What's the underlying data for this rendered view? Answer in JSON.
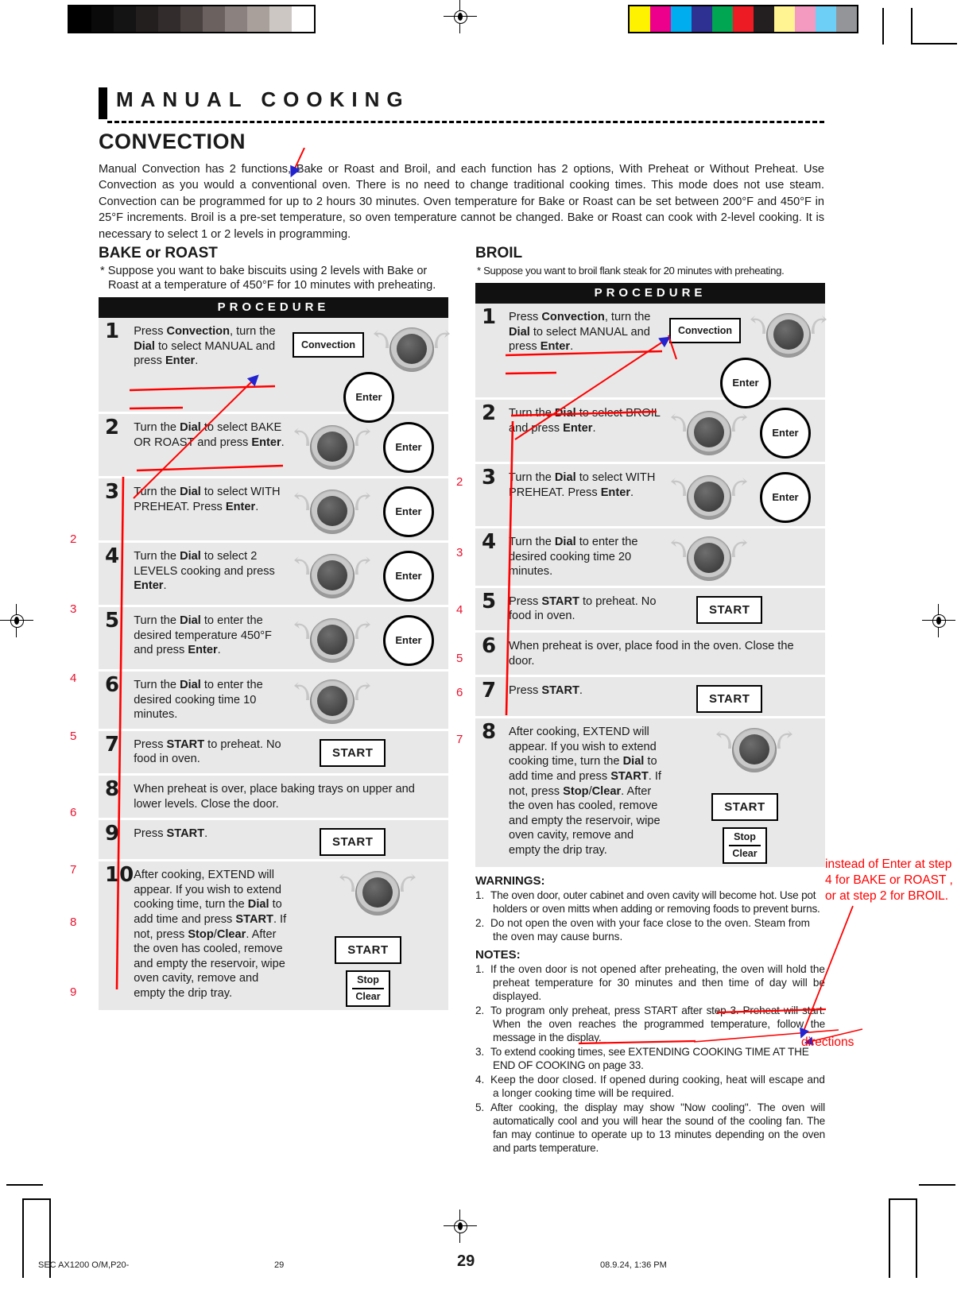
{
  "print": {
    "grey_swatches": [
      "#000000",
      "#0a0a0a",
      "#141414",
      "#241f1f",
      "#322c2c",
      "#4a4240",
      "#6b6260",
      "#8b817e",
      "#a9a09c",
      "#cdc7c3",
      "#ffffff"
    ],
    "color_swatches": [
      "#fff200",
      "#ec008c",
      "#00aeef",
      "#2e3192",
      "#00a651",
      "#ed1c24",
      "#231f20",
      "#fff392",
      "#f49ac1",
      "#6dcff6",
      "#939598"
    ],
    "registration_icon": "registration-target-icon"
  },
  "header": {
    "title": "MANUAL COOKING",
    "section_title": "CONVECTION",
    "intro": "Manual Convection has 2 functions, Bake or Roast and Broil, and each function has 2 options, With Preheat or Without Preheat. Use Convection as you would a conventional oven. There is no need to change traditional cooking times. This mode does not use steam. Convection can be programmed for up to 2 hours 30 minutes. Oven temperature for Bake or Roast can be set between 200°F and 450°F in 25°F increments. Broil is a pre-set temperature, so oven temperature cannot be changed. Bake or Roast can cook with 2-level cooking. It is necessary to select 1 or 2 levels in programming."
  },
  "left": {
    "heading": "BAKE or ROAST",
    "suppose": "* Suppose you want to bake biscuits using 2 levels with Bake or Roast at a temperature of 450°F for 10 minutes with preheating.",
    "procedure_label": "PROCEDURE",
    "steps": [
      {
        "num": "1",
        "text": "Press Convection, turn the Dial to select MANUAL and press Enter.",
        "bold": [
          "Convection",
          "Dial",
          "Enter"
        ],
        "art": [
          "convection-button",
          "dial-knob",
          "enter-button"
        ]
      },
      {
        "num": "2",
        "text": "Turn the Dial to select BAKE OR ROAST and press Enter.",
        "bold": [
          "Dial",
          "Enter"
        ],
        "art": [
          "dial-knob",
          "enter-button"
        ]
      },
      {
        "num": "3",
        "text": "Turn the Dial to select WITH PREHEAT. Press Enter.",
        "bold": [
          "Dial",
          "Enter"
        ],
        "art": [
          "dial-knob",
          "enter-button"
        ]
      },
      {
        "num": "4",
        "text": "Turn the Dial to select 2 LEVELS cooking and press Enter.",
        "bold": [
          "Dial",
          "Enter"
        ],
        "art": [
          "dial-knob",
          "enter-button"
        ]
      },
      {
        "num": "5",
        "text": "Turn the Dial to enter the desired temperature 450°F and press Enter.",
        "bold": [
          "Dial",
          "Enter"
        ],
        "art": [
          "dial-knob",
          "enter-button"
        ]
      },
      {
        "num": "6",
        "text": "Turn the Dial to enter the desired cooking time 10 minutes.",
        "bold": [
          "Dial"
        ],
        "art": [
          "dial-knob"
        ]
      },
      {
        "num": "7",
        "text": "Press START to preheat. No food in oven.",
        "bold": [
          "START"
        ],
        "art": [
          "start-button"
        ]
      },
      {
        "num": "8",
        "text": "When preheat is over, place baking trays on upper and lower levels. Close the door.",
        "bold": [],
        "art": []
      },
      {
        "num": "9",
        "text": "Press START.",
        "bold": [
          "START"
        ],
        "art": [
          "start-button"
        ]
      },
      {
        "num": "10",
        "text": "After cooking, EXTEND will appear. If you wish to extend cooking time, turn the Dial to add time and press START. If not, press Stop/Clear. After the oven has cooled, remove and empty the reservoir, wipe oven cavity, remove and empty the drip tray.",
        "bold": [
          "Dial",
          "START",
          "Stop",
          "Clear"
        ],
        "art": [
          "dial-knob",
          "start-button",
          "stop-clear-button"
        ]
      }
    ]
  },
  "right": {
    "heading": "BROIL",
    "suppose": "*  Suppose you want to broil flank steak for 20 minutes with preheating.",
    "procedure_label": "PROCEDURE",
    "steps": [
      {
        "num": "1",
        "text": "Press Convection, turn the Dial to select MANUAL and press Enter.",
        "bold": [
          "Convection",
          "Dial",
          "Enter"
        ],
        "art": [
          "convection-button",
          "dial-knob",
          "enter-button"
        ]
      },
      {
        "num": "2",
        "text": "Turn the Dial to select BROIL and press Enter.",
        "bold": [
          "Dial",
          "Enter"
        ],
        "art": [
          "dial-knob",
          "enter-button"
        ]
      },
      {
        "num": "3",
        "text": "Turn the Dial to select WITH PREHEAT. Press Enter.",
        "bold": [
          "Dial",
          "Enter"
        ],
        "art": [
          "dial-knob",
          "enter-button"
        ]
      },
      {
        "num": "4",
        "text": "Turn the Dial to enter the desired cooking time 20 minutes.",
        "bold": [
          "Dial"
        ],
        "art": [
          "dial-knob"
        ]
      },
      {
        "num": "5",
        "text": "Press START to preheat. No food in oven.",
        "bold": [
          "START"
        ],
        "art": [
          "start-button"
        ]
      },
      {
        "num": "6",
        "text": "When preheat is over, place food in the oven. Close the door.",
        "bold": [],
        "art": []
      },
      {
        "num": "7",
        "text": "Press START.",
        "bold": [
          "START"
        ],
        "art": [
          "start-button"
        ]
      },
      {
        "num": "8",
        "text": "After cooking, EXTEND will appear. If you wish to extend cooking time, turn the Dial to add time and press START. If not, press Stop/Clear. After the oven has cooled, remove and empty the reservoir, wipe oven cavity, remove and empty the drip tray.",
        "bold": [
          "Dial",
          "START",
          "Stop",
          "Clear"
        ],
        "art": [
          "dial-knob",
          "start-button",
          "stop-clear-button"
        ]
      }
    ],
    "warnings_title": "WARNINGS:",
    "warnings": [
      "The oven door, outer cabinet and oven cavity will become hot. Use pot holders or oven mitts when adding or removing foods to prevent burns.",
      "Do not open the oven with your face close  to the oven. Steam from the oven may cause burns."
    ],
    "notes_title": "NOTES:",
    "notes": [
      "If the oven door is not opened after preheating, the oven will hold the preheat temperature for 30 minutes and then time of day will be displayed.",
      "To program only preheat, press START after step 3. Preheat will start. When the oven reaches the programmed temperature, follow the message in the display.",
      "To extend cooking times, see EXTENDING COOKING TIME AT THE END OF COOKING on page 33.",
      "Keep the door closed. If opened during cooking, heat will escape and a longer cooking time will be required.",
      "After cooking, the display may show \"Now cooling\". The oven will automatically cool and you will hear the sound of the cooling fan. The fan may continue to operate up to 13 minutes depending on the oven and parts temperature."
    ]
  },
  "annotations": {
    "color": "#ff0000",
    "left_margin_numbers": [
      "2",
      "3",
      "4",
      "5",
      "6",
      "7",
      "8",
      "9"
    ],
    "right_margin_numbers": [
      "2",
      "3",
      "4",
      "5",
      "6",
      "7"
    ],
    "note": "instead of Enter at step 4 for BAKE or ROAST , or at step 2 for BROIL.",
    "directions": "directions"
  },
  "page": {
    "number": "29",
    "footer_left": "SEC AX1200 O/M,P20-",
    "footer_center": "29",
    "footer_right": "08.9.24, 1:36 PM"
  },
  "icons": {
    "convection": "convection-button-icon",
    "enter": "enter-button-icon",
    "start": "start-button-icon",
    "stop": "Stop",
    "clear": "Clear",
    "dial": "dial-knob-icon",
    "arrow_left": "rotate-left-arrow-icon",
    "arrow_right": "rotate-right-arrow-icon"
  }
}
